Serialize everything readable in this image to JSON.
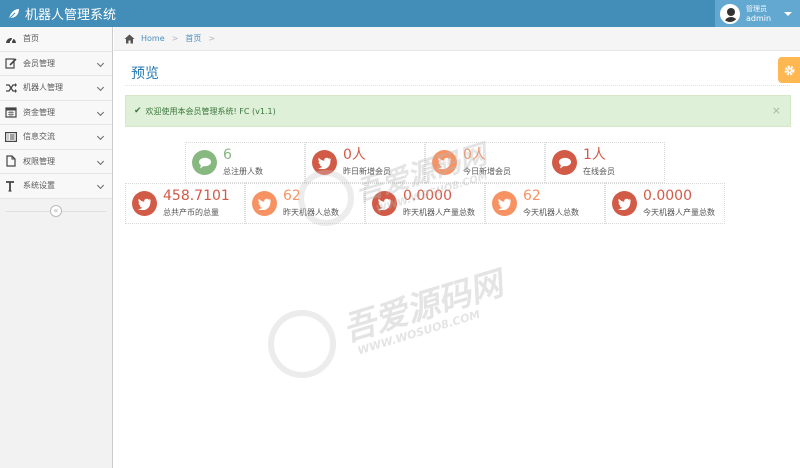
{
  "app": {
    "title": "机器人管理系统"
  },
  "user": {
    "role": "管理员",
    "name": "admin"
  },
  "sidebar": {
    "items": [
      {
        "label": "首页",
        "icon": "dashboard-icon",
        "has_children": false
      },
      {
        "label": "会员管理",
        "icon": "edit-icon",
        "has_children": true
      },
      {
        "label": "机器人管理",
        "icon": "shuffle-icon",
        "has_children": true
      },
      {
        "label": "资金管理",
        "icon": "calendar-icon",
        "has_children": true
      },
      {
        "label": "信息交流",
        "icon": "list-alt-icon",
        "has_children": true
      },
      {
        "label": "权限管理",
        "icon": "file-icon",
        "has_children": true
      },
      {
        "label": "系统设置",
        "icon": "text-height-icon",
        "has_children": true
      }
    ],
    "collapse_label": "«"
  },
  "breadcrumb": {
    "home": "Home",
    "current": "首页"
  },
  "page": {
    "title": "预览"
  },
  "alert": {
    "text": "欢迎使用本会员管理系统! FC (v1.1)",
    "close": "×"
  },
  "stats": {
    "row1": [
      {
        "value": "6",
        "label": "总注册人数",
        "color": "green",
        "icon": "comments-icon"
      },
      {
        "value": "0人",
        "label": "昨日新增会员",
        "color": "red",
        "icon": "twitter-icon"
      },
      {
        "value": "0人",
        "label": "今日新增会员",
        "color": "orange",
        "icon": "twitter-icon"
      },
      {
        "value": "1人",
        "label": "在线会员",
        "color": "red",
        "icon": "comments-icon"
      }
    ],
    "row2": [
      {
        "value": "458.7101",
        "label": "总共产币的总量",
        "color": "red",
        "icon": "twitter-icon"
      },
      {
        "value": "62",
        "label": "昨天机器人总数",
        "color": "orange",
        "icon": "twitter-icon"
      },
      {
        "value": "0.0000",
        "label": "昨天机器人产量总数",
        "color": "red",
        "icon": "twitter-icon"
      },
      {
        "value": "62",
        "label": "今天机器人总数",
        "color": "orange",
        "icon": "twitter-icon"
      },
      {
        "value": "0.0000",
        "label": "今天机器人产量总数",
        "color": "red",
        "icon": "twitter-icon"
      }
    ]
  },
  "watermark": {
    "text": "吾爱源码网",
    "url": "WWW.WOSUO8.COM"
  },
  "colors": {
    "navbar": "#438eb9",
    "green": "#87b87f",
    "red": "#d15b47",
    "orange": "#f79263",
    "title": "#2679b5"
  }
}
